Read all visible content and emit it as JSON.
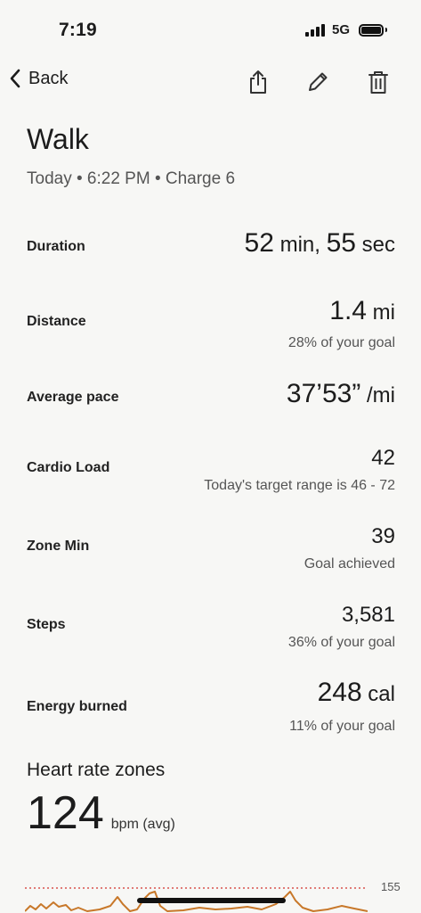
{
  "status": {
    "time": "7:19",
    "network": "5G"
  },
  "nav": {
    "back_label": "Back"
  },
  "header": {
    "title": "Walk",
    "subtitle": "Today • 6:22 PM • Charge 6"
  },
  "metrics": [
    {
      "label": "Duration",
      "value": "52",
      "unit": " min, ",
      "value2": "55",
      "unit2": " sec"
    },
    {
      "label": "Distance",
      "value": "1.4",
      "unit": " mi",
      "sub": "28% of your goal"
    },
    {
      "label": "Average pace",
      "value": "37’53”",
      "unit": " /mi"
    },
    {
      "label": "Cardio Load",
      "value": "42",
      "sub": "Today's target range is 46 - 72"
    },
    {
      "label": "Zone Min",
      "value": "39",
      "sub": "Goal achieved"
    },
    {
      "label": "Steps",
      "value": "3,581",
      "sub": "36% of your goal"
    },
    {
      "label": "Energy burned",
      "value": "248",
      "unit": " cal",
      "sub": "11% of your goal"
    }
  ],
  "heart_rate": {
    "title": "Heart rate zones",
    "avg": "124",
    "unit": "bpm (avg)",
    "chart_max_label": "155"
  },
  "colors": {
    "background": "#f7f7f5",
    "hr_line": "#c8782a",
    "max_line": "#d9534f"
  }
}
